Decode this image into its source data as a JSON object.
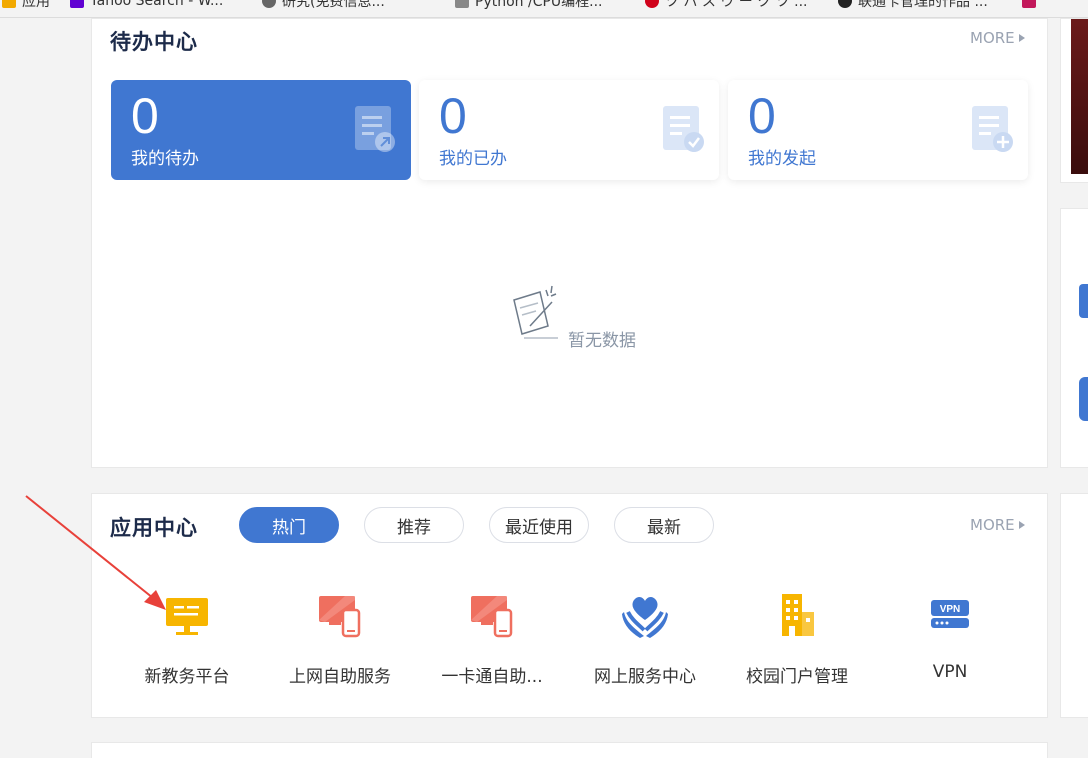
{
  "bookmarks": [
    "应用",
    "Yahoo Search - W...",
    "研究(免费信息...",
    "Python /CPU编程...",
    "ツ バ ス ウ ー ク ツ ...",
    "联通卡管理的作品 ..."
  ],
  "todo": {
    "title": "待办中心",
    "more": "MORE",
    "cards": [
      {
        "count": "0",
        "label": "我的待办",
        "icon": "doc-pin-icon"
      },
      {
        "count": "0",
        "label": "我的已办",
        "icon": "doc-check-icon"
      },
      {
        "count": "0",
        "label": "我的发起",
        "icon": "doc-plus-icon"
      }
    ],
    "empty_text": "暂无数据"
  },
  "apps": {
    "title": "应用中心",
    "more": "MORE",
    "tabs": [
      "热门",
      "推荐",
      "最近使用",
      "最新"
    ],
    "active_tab": "热门",
    "items": [
      {
        "label": "新教务平台",
        "icon": "monitor-icon",
        "color": "#f7b500"
      },
      {
        "label": "上网自助服务",
        "icon": "devices-icon",
        "color": "#ef6f5f"
      },
      {
        "label": "一卡通自助...",
        "icon": "devices-icon",
        "color": "#ef6f5f"
      },
      {
        "label": "网上服务中心",
        "icon": "hands-heart-icon",
        "color": "#4077d1"
      },
      {
        "label": "校园门户管理",
        "icon": "building-icon",
        "color": "#f7b500"
      },
      {
        "label": "VPN",
        "icon": "vpn-icon",
        "color": "#4077d1"
      }
    ]
  },
  "colors": {
    "accent": "#4077d1",
    "arrow": "#e8413a"
  }
}
